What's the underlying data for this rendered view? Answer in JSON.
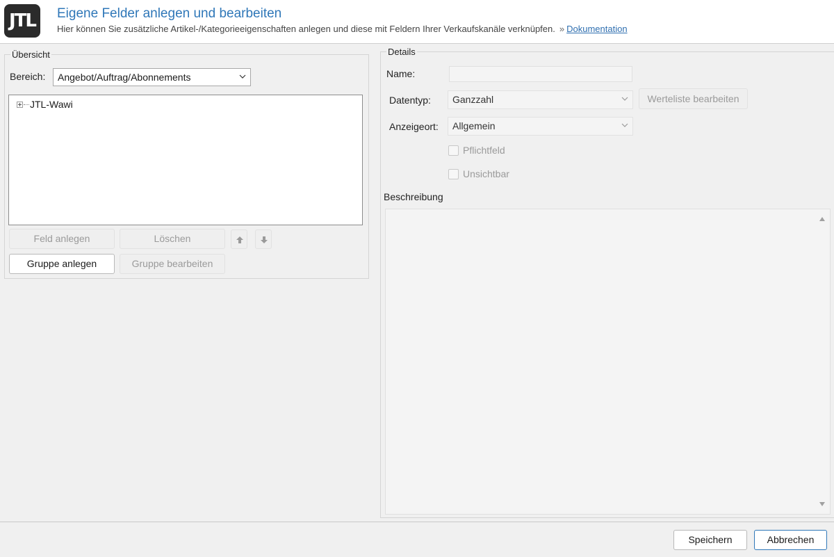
{
  "header": {
    "logo_text": "JTL",
    "title": "Eigene Felder anlegen und bearbeiten",
    "subtitle": "Hier können Sie zusätzliche Artikel-/Kategorieeigenschaften anlegen und diese mit Feldern Ihrer Verkaufskanäle verknüpfen.",
    "raquo": "»",
    "doc_link": "Dokumentation",
    "link_color": "#2f6fb0",
    "title_color": "#2f77b8"
  },
  "overview": {
    "legend": "Übersicht",
    "bereich_label": "Bereich:",
    "bereich_value": "Angebot/Auftrag/Abonnements",
    "tree_root": "JTL-Wawi",
    "buttons": {
      "feld_anlegen": "Feld anlegen",
      "loeschen": "Löschen",
      "gruppe_anlegen": "Gruppe anlegen",
      "gruppe_bearbeiten": "Gruppe bearbeiten"
    }
  },
  "details": {
    "legend": "Details",
    "name_label": "Name:",
    "name_value": "",
    "datentyp_label": "Datentyp:",
    "datentyp_value": "Ganzzahl",
    "werteliste_button": "Werteliste bearbeiten",
    "anzeigeort_label": "Anzeigeort:",
    "anzeigeort_value": "Allgemein",
    "pflichtfeld_label": "Pflichtfeld",
    "unsichtbar_label": "Unsichtbar",
    "beschreibung_label": "Beschreibung"
  },
  "footer": {
    "save_label": "Speichern",
    "cancel_label": "Abbrechen",
    "accent": "#2f77b8"
  }
}
